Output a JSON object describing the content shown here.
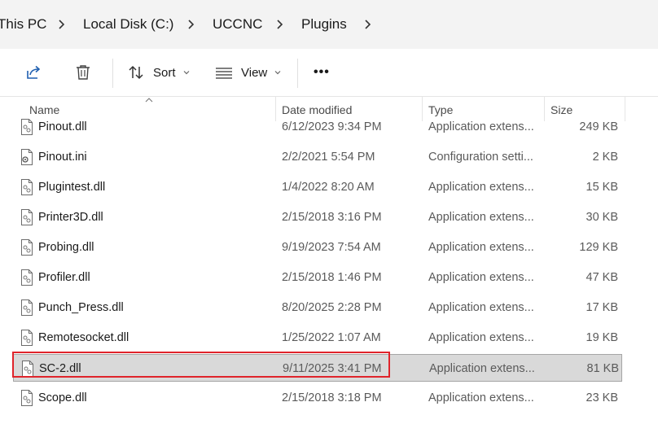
{
  "breadcrumb": {
    "items": [
      "This PC",
      "Local Disk (C:)",
      "UCCNC",
      "Plugins"
    ]
  },
  "toolbar": {
    "share_icon": "share-icon",
    "delete_icon": "trash-icon",
    "sort_label": "Sort",
    "view_label": "View",
    "more_label": "•••"
  },
  "columns": {
    "name": "Name",
    "date": "Date modified",
    "type": "Type",
    "size": "Size"
  },
  "files": [
    {
      "name": "Pinout.dll",
      "date": "6/12/2023 9:34 PM",
      "type": "Application extens...",
      "size": "249 KB",
      "icon": "dll-file-icon"
    },
    {
      "name": "Pinout.ini",
      "date": "2/2/2021 5:54 PM",
      "type": "Configuration setti...",
      "size": "2 KB",
      "icon": "ini-file-icon"
    },
    {
      "name": "Plugintest.dll",
      "date": "1/4/2022 8:20 AM",
      "type": "Application extens...",
      "size": "15 KB",
      "icon": "dll-file-icon"
    },
    {
      "name": "Printer3D.dll",
      "date": "2/15/2018 3:16 PM",
      "type": "Application extens...",
      "size": "30 KB",
      "icon": "dll-file-icon"
    },
    {
      "name": "Probing.dll",
      "date": "9/19/2023 7:54 AM",
      "type": "Application extens...",
      "size": "129 KB",
      "icon": "dll-file-icon"
    },
    {
      "name": "Profiler.dll",
      "date": "2/15/2018 1:46 PM",
      "type": "Application extens...",
      "size": "47 KB",
      "icon": "dll-file-icon"
    },
    {
      "name": "Punch_Press.dll",
      "date": "8/20/2025 2:28 PM",
      "type": "Application extens...",
      "size": "17 KB",
      "icon": "dll-file-icon"
    },
    {
      "name": "Remotesocket.dll",
      "date": "1/25/2022 1:07 AM",
      "type": "Application extens...",
      "size": "19 KB",
      "icon": "dll-file-icon"
    },
    {
      "name": "SC-2.dll",
      "date": "9/11/2025 3:41 PM",
      "type": "Application extens...",
      "size": "81 KB",
      "icon": "dll-file-icon",
      "selected": true
    },
    {
      "name": "Scope.dll",
      "date": "2/15/2018 3:18 PM",
      "type": "Application extens...",
      "size": "23 KB",
      "icon": "dll-file-icon"
    }
  ],
  "colors": {
    "selection_bg": "#d9d9d9",
    "highlight_border": "#e0242b"
  }
}
